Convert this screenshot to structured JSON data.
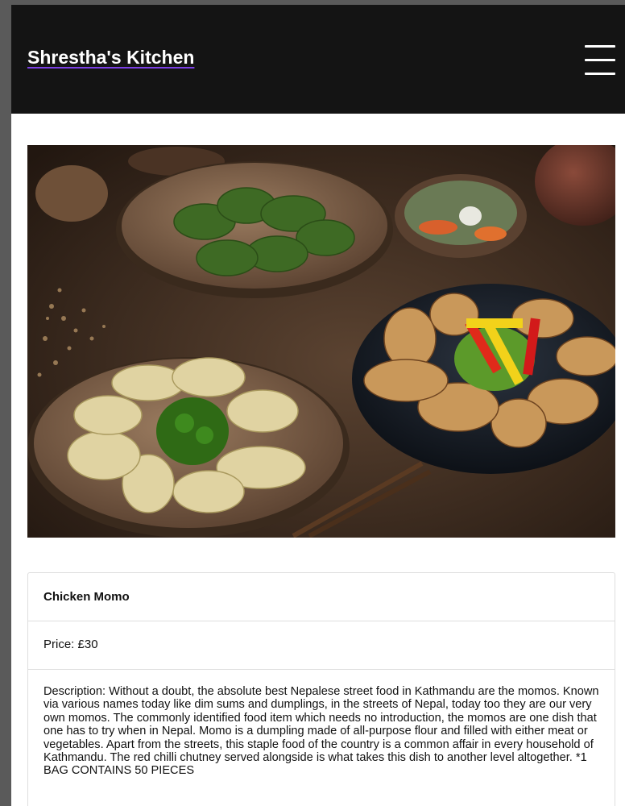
{
  "navbar": {
    "brand": "Shrestha's Kitchen",
    "menu_icon": "hamburger-menu-icon"
  },
  "hero_image": {
    "subject": "momo-dumplings-photo"
  },
  "product": {
    "name": "Chicken Momo",
    "price": "Price: £30",
    "description": "Description: Without a doubt, the absolute best Nepalese street food in Kathmandu are the momos. Known via various names today like dim sums and dumplings, in the streets of Nepal, today too they are our very own momos. The commonly identified food item which needs no introduction, the momos are one dish that one has to try when in Nepal. Momo is a dumpling made of all-purpose flour and filled with either meat or vegetables. Apart from the streets, this staple food of the country is a common affair in every household of Kathmandu. The red chilli chutney served alongside is what takes this dish to another level altogether. *1 BAG CONTAINS 50 PIECES"
  },
  "colors": {
    "navbar_bg": "#141414",
    "brand_text": "#ffffff",
    "brand_underline": "#7b3fe4",
    "card_border": "#dedede"
  }
}
